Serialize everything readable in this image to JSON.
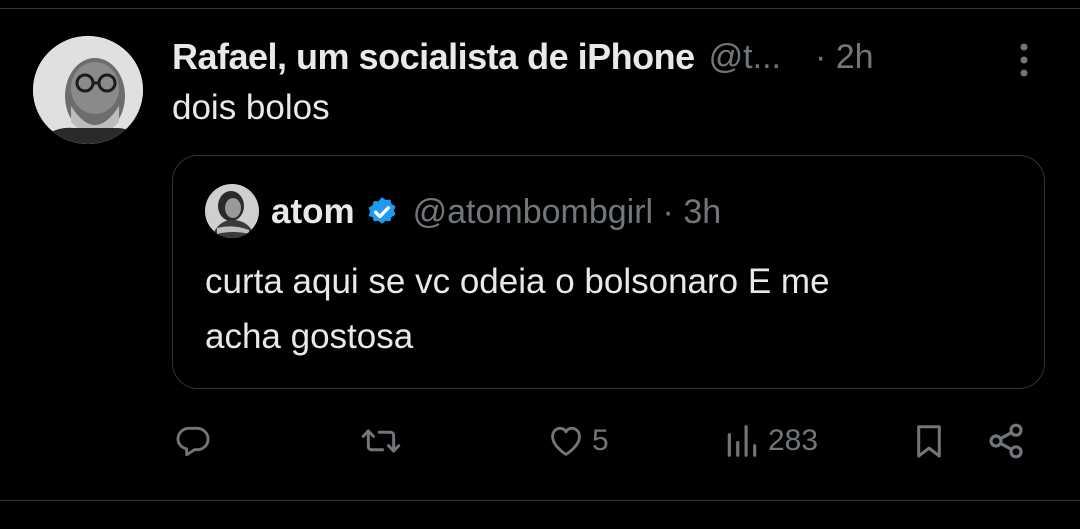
{
  "tweet": {
    "display_name": "Rafael, um socialista de iPhone",
    "handle": "@t...",
    "time": "· 2h",
    "text": "dois bolos",
    "avatar_icon": "user-avatar-photo",
    "more_icon": "more-vertical-icon"
  },
  "quoted": {
    "display_name": "atom",
    "verified": true,
    "handle": "@atombombgirl · 3h",
    "text_line1": "curta aqui se vc odeia o bolsonaro E me",
    "text_line2": "acha gostosa",
    "verified_color": "#1d9bf0"
  },
  "actions": {
    "reply_icon": "reply-icon",
    "repost_icon": "repost-icon",
    "like_icon": "heart-icon",
    "like_count": "5",
    "views_icon": "views-icon",
    "views_count": "283",
    "bookmark_icon": "bookmark-icon",
    "share_icon": "share-icon"
  },
  "colors": {
    "background": "#000000",
    "text_primary": "#e7e9ea",
    "text_secondary": "#71767b",
    "border": "#2f3336",
    "accent": "#1d9bf0"
  }
}
